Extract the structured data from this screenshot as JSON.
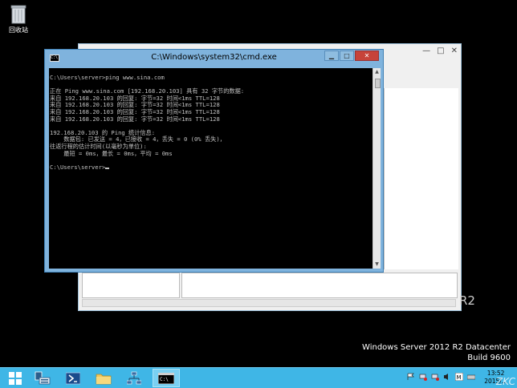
{
  "desktop": {
    "recycle_bin_label": "回收站",
    "r2_fragment": "R2",
    "os_name": "Windows Server 2012 R2 Datacenter",
    "os_build": "Build 9600"
  },
  "cmd_window": {
    "title": "C:\\Windows\\system32\\cmd.exe",
    "icon_text": "C:\\",
    "minimize_label": "▁",
    "maximize_label": "□",
    "close_label": "✕",
    "console_text": "C:\\Users\\server>ping www.sina.com\n\n正在 Ping www.sina.com [192.168.20.103] 具有 32 字节的数据:\n来自 192.168.20.103 的回复: 字节=32 时间<1ms TTL=128\n来自 192.168.20.103 的回复: 字节=32 时间<1ms TTL=128\n来自 192.168.20.103 的回复: 字节=32 时间<1ms TTL=128\n来自 192.168.20.103 的回复: 字节=32 时间<1ms TTL=128\n\n192.168.20.103 的 Ping 统计信息:\n    数据包: 已发送 = 4，已接收 = 4，丢失 = 0 (0% 丢失)，\n往返行程的估计时间(以毫秒为单位):\n    最短 = 0ms，最长 = 0ms，平均 = 0ms\n\nC:\\Users\\server>"
  },
  "bg_window": {
    "minimize_label": "—",
    "maximize_label": "□",
    "close_label": "✕"
  },
  "taskbar": {
    "clock_time": "13:52",
    "clock_date": "2015/..."
  },
  "watermark": "ZKC",
  "colors": {
    "taskbar": "#3fb6e6",
    "cmd_frame": "#7fb3dd",
    "close_button": "#c7433a",
    "console_text": "#c0c0c0"
  }
}
